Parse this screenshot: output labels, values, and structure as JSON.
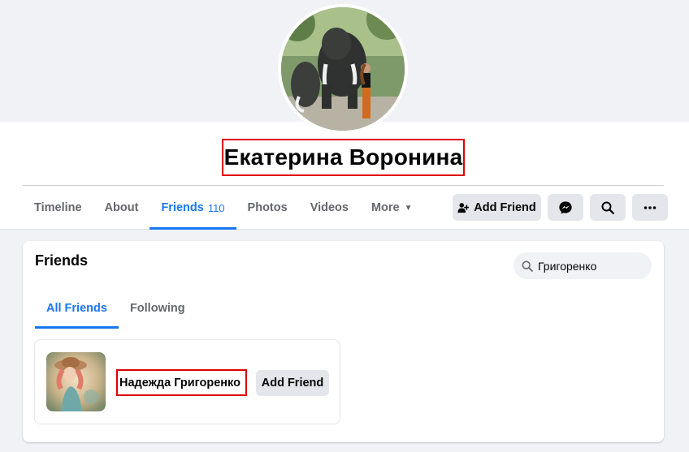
{
  "profile": {
    "name": "Екатерина Воронина"
  },
  "nav": {
    "tabs": [
      {
        "label": "Timeline"
      },
      {
        "label": "About"
      },
      {
        "label": "Friends",
        "count": "110"
      },
      {
        "label": "Photos"
      },
      {
        "label": "Videos"
      },
      {
        "label": "More"
      }
    ],
    "active_tab": "Friends"
  },
  "actions": {
    "add_friend_label": "Add Friend",
    "icons": [
      "add-friend-icon",
      "messenger-icon",
      "search-icon",
      "more-dots-icon"
    ]
  },
  "friends_section": {
    "title": "Friends",
    "search": {
      "value": "Григоренко"
    },
    "subtabs": [
      {
        "label": "All Friends"
      },
      {
        "label": "Following"
      }
    ],
    "active_subtab": "All Friends",
    "results": [
      {
        "name": "Надежда Григоренко",
        "button_label": "Add Friend"
      }
    ]
  },
  "colors": {
    "accent": "#1877f2",
    "highlight_border": "#e00000",
    "button_bg": "#e4e6eb",
    "page_bg": "#f0f2f5"
  }
}
